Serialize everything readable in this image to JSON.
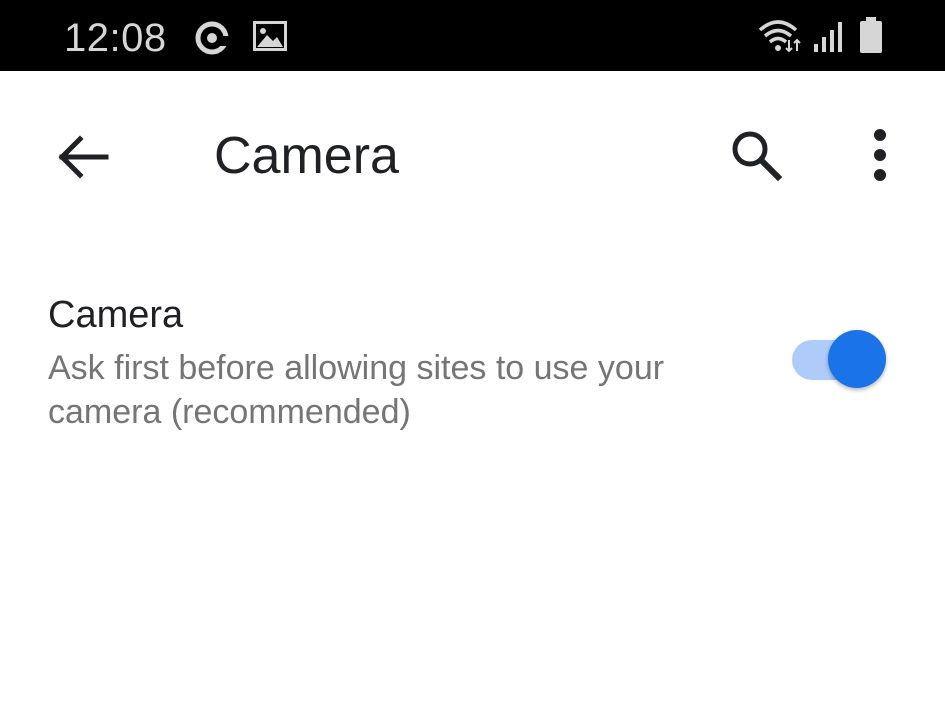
{
  "status_bar": {
    "time": "12:08",
    "icons": [
      "at-sign-notification-icon",
      "image-notification-icon",
      "wifi-icon",
      "cellular-signal-icon",
      "battery-icon"
    ]
  },
  "toolbar": {
    "title": "Camera",
    "back_icon": "arrow-left-icon",
    "search_icon": "search-icon",
    "more_icon": "more-vertical-icon"
  },
  "setting": {
    "title": "Camera",
    "summary": "Ask first before allowing sites to use your camera (recommended)",
    "toggle_on": true
  },
  "colors": {
    "accent": "#1a73e8",
    "track": "#aecbfa",
    "primary_text": "#202124",
    "secondary_text": "#757575",
    "status_bar_bg": "#000000"
  }
}
